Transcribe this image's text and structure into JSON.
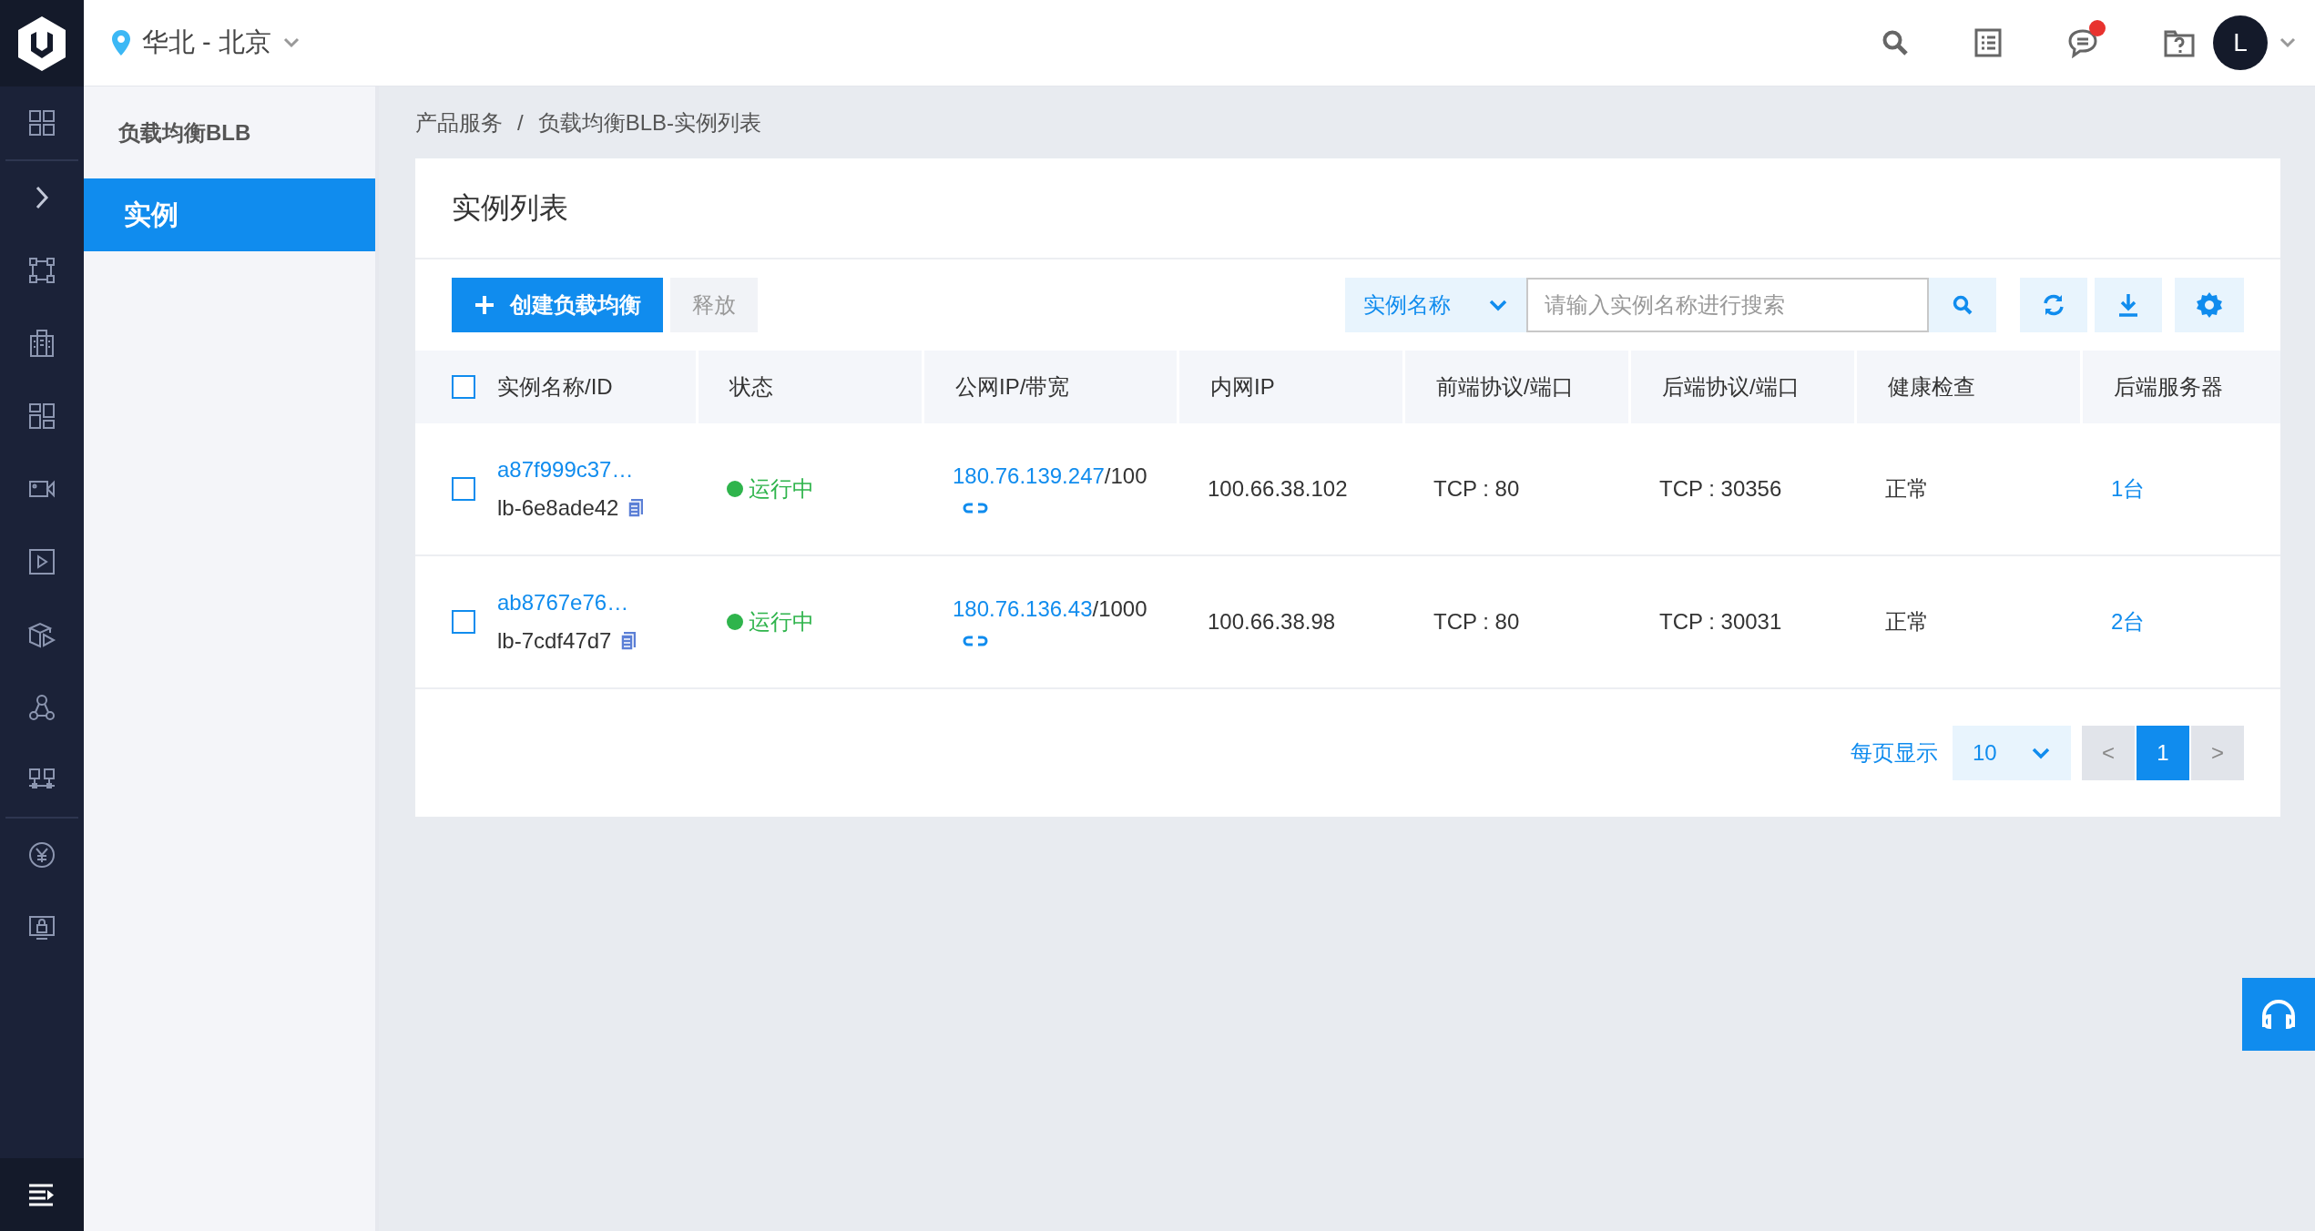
{
  "region": {
    "label": "华北 - 北京"
  },
  "messages": {
    "unread": true
  },
  "user": {
    "initial": "L"
  },
  "sidebar": {
    "title": "负载均衡BLB",
    "items": [
      {
        "label": "实例",
        "selected": true
      }
    ]
  },
  "breadcrumb": {
    "items": [
      "产品服务",
      "负载均衡BLB-实例列表"
    ],
    "separator": "/"
  },
  "card": {
    "title": "实例列表"
  },
  "toolbar": {
    "create_button": "创建负载均衡",
    "release_button": {
      "label": "释放",
      "disabled": true
    },
    "search": {
      "field": "实例名称",
      "placeholder": "请输入实例名称进行搜索"
    }
  },
  "table": {
    "select_all": {
      "checked": false
    },
    "columns": [
      "实例名称/ID",
      "状态",
      "公网IP/带宽",
      "内网IP",
      "前端协议/端口",
      "后端协议/端口",
      "健康检查",
      "后端服务器"
    ],
    "rows": [
      {
        "checked": false,
        "name": "a87f999c37…",
        "id": "lb-6e8ade42",
        "status": "运行中",
        "public_ip": "180.76.139.247",
        "bandwidth": "/100",
        "private_ip": "100.66.38.102",
        "frontend": "TCP : 80",
        "backend": "TCP : 30356",
        "health": "正常",
        "servers": "1台"
      },
      {
        "checked": false,
        "name": "ab8767e76…",
        "id": "lb-7cdf47d7",
        "status": "运行中",
        "public_ip": "180.76.136.43",
        "bandwidth": "/1000",
        "private_ip": "100.66.38.98",
        "frontend": "TCP : 80",
        "backend": "TCP : 30031",
        "health": "正常",
        "servers": "2台"
      }
    ]
  },
  "pagination": {
    "label": "每页显示",
    "page_size": "10",
    "prev": "<",
    "next": ">",
    "pages": [
      {
        "label": "1",
        "selected": true
      }
    ]
  }
}
